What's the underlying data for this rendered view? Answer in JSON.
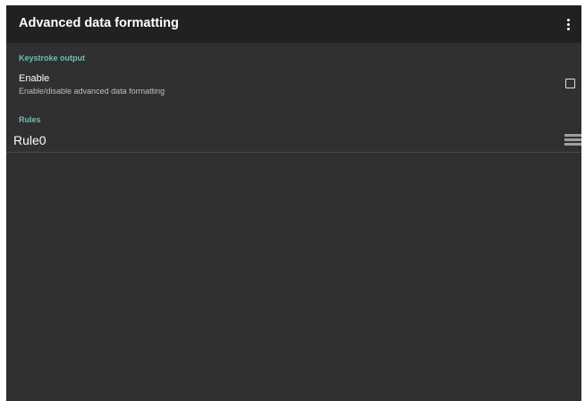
{
  "app_bar": {
    "title": "Advanced data formatting",
    "overflow_icon": "more-vert-icon"
  },
  "keystroke_output": {
    "header": "Keystroke output",
    "enable": {
      "title": "Enable",
      "summary": "Enable/disable advanced data formatting",
      "checked": false
    }
  },
  "rules": {
    "header": "Rules",
    "items": [
      {
        "label": "Rule0",
        "handle_icon": "drag-handle-icon"
      }
    ]
  },
  "colors": {
    "app_bar_bg": "#212121",
    "content_bg": "#303030",
    "accent": "#6fbfb4",
    "text_primary": "#ffffff",
    "text_secondary": "#bdbdbd"
  }
}
